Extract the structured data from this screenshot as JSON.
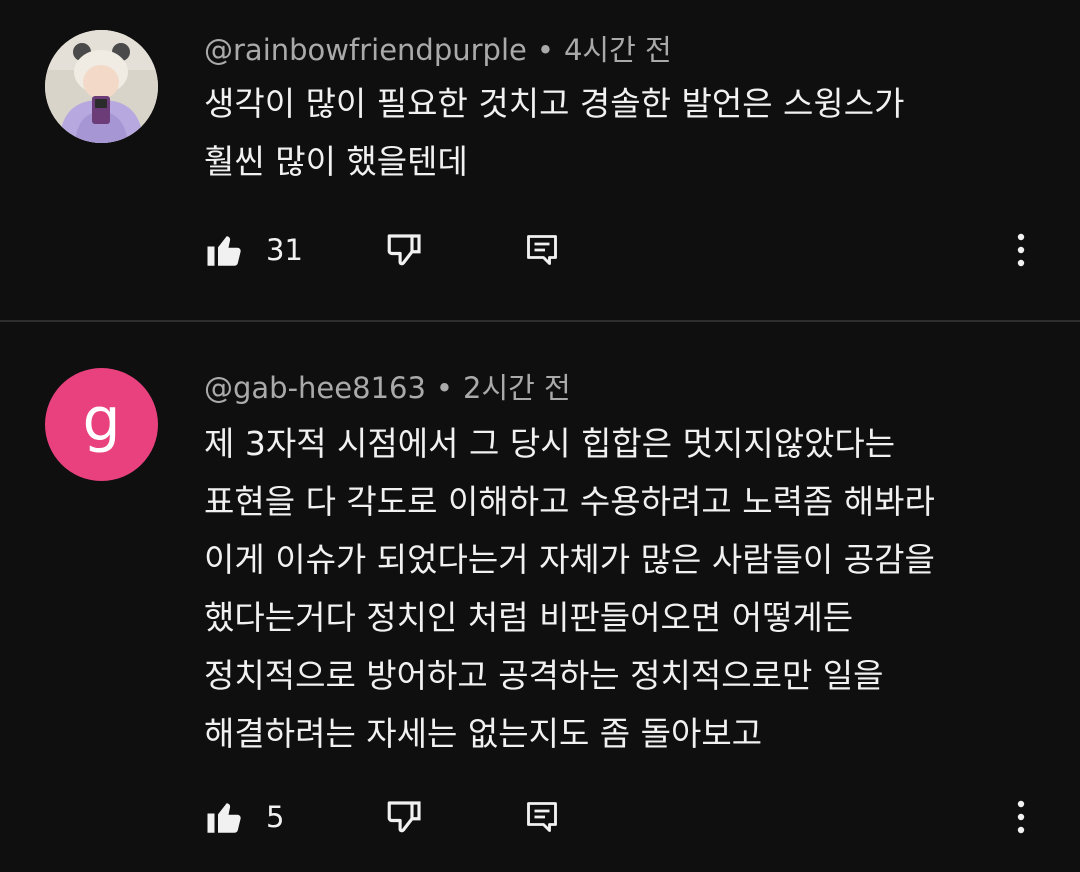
{
  "comments": [
    {
      "author": "@rainbowfriendpurple",
      "separator": "•",
      "time": "4시간 전",
      "text": "생각이 많이 필요한 것치고 경솔한 발언은 스윙스가\n훨씬 많이 했을텐데",
      "likes": "31",
      "avatar": {
        "type": "photo",
        "bg": "#d9d4c9"
      }
    },
    {
      "author": "@gab-hee8163",
      "separator": "•",
      "time": "2시간 전",
      "text": "제 3자적 시점에서 그 당시 힙합은 멋지지않았다는\n표현을 다 각도로 이해하고 수용하려고 노력좀 해봐라\n이게 이슈가 되었다는거 자체가 많은 사람들이 공감을\n했다는거다 정치인 처럼 비판들어오면 어떻게든\n정치적으로 방어하고 공격하는 정치적으로만 일을\n해결하려는 자세는 없는지도 좀 돌아보고",
      "likes": "5",
      "avatar": {
        "type": "letter",
        "letter": "g",
        "bg": "#e8417e"
      }
    }
  ],
  "icons": {
    "like": "thumbs-up-icon",
    "dislike": "thumbs-down-icon",
    "reply": "reply-icon",
    "more": "more-vert-icon"
  },
  "colors": {
    "background": "#0f0f0f",
    "text": "#f1f1f1",
    "meta": "#aaaaaa",
    "divider": "#2e2e2e"
  }
}
